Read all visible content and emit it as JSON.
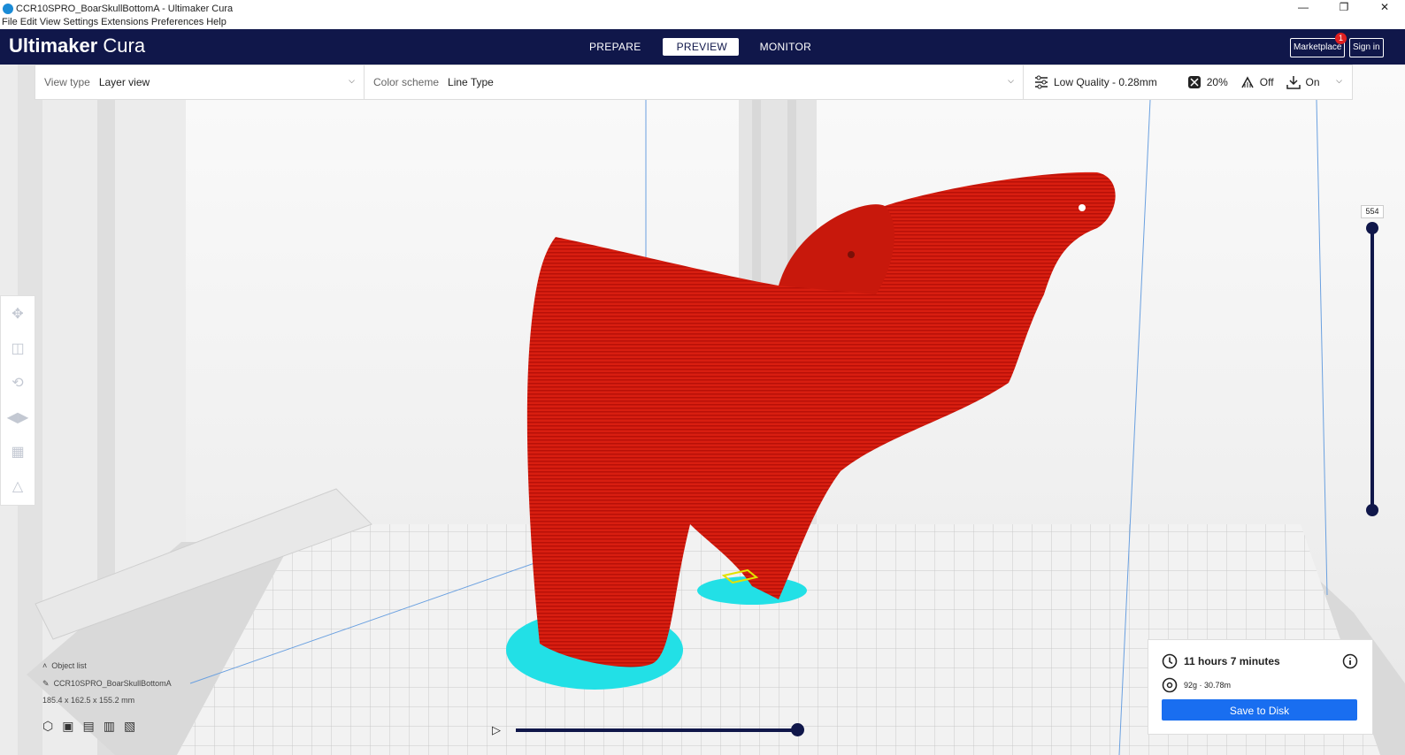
{
  "window": {
    "title": "CCR10SPRO_BoarSkullBottomA - Ultimaker Cura",
    "minimize": "—",
    "restore": "❐",
    "close": "✕"
  },
  "menu": [
    "File",
    "Edit",
    "View",
    "Settings",
    "Extensions",
    "Preferences",
    "Help"
  ],
  "header": {
    "logo_bold": "Ultimaker",
    "logo_light": "Cura",
    "stages": [
      "PREPARE",
      "PREVIEW",
      "MONITOR"
    ],
    "active_stage": "PREVIEW",
    "marketplace": "Marketplace",
    "marketplace_badge": "1",
    "sign_in": "Sign in"
  },
  "toolbar": {
    "view_type_label": "View type",
    "view_type_value": "Layer view",
    "color_scheme_label": "Color scheme",
    "color_scheme_value": "Line Type",
    "quality": "Low Quality - 0.28mm",
    "infill": "20%",
    "support": "Off",
    "adhesion": "On"
  },
  "layer_slider": {
    "current_layer": "554"
  },
  "object_list": {
    "title": "Object list",
    "object_name": "CCR10SPRO_BoarSkullBottomA",
    "dimensions": "185.4 x 162.5 x 155.2 mm"
  },
  "print_info": {
    "time": "11 hours 7 minutes",
    "material": "92g · 30.78m",
    "save_label": "Save to Disk"
  },
  "colors": {
    "header": "#10174a",
    "accent": "#196ef0",
    "model": "#d81e10",
    "skirt": "#22e0e6"
  }
}
